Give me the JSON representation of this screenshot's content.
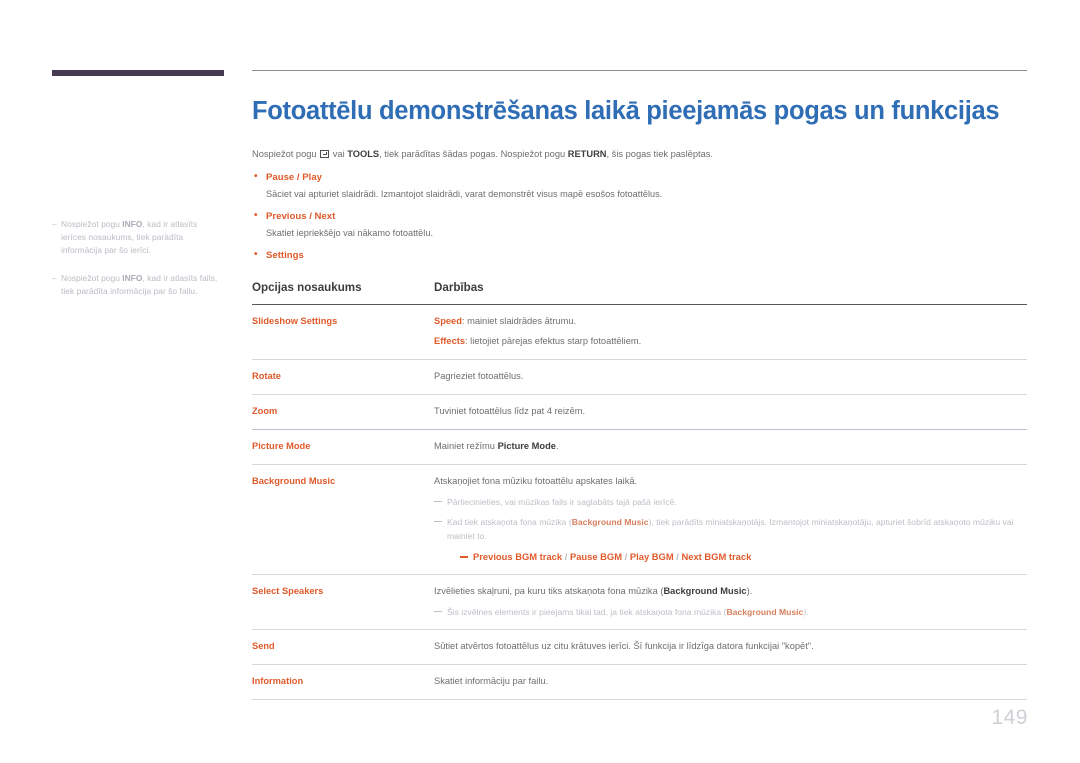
{
  "header": {
    "title": "Fotoattēlu demonstrēšanas laikā pieejamās pogas un funkcijas"
  },
  "intro": {
    "part1": "Nospiežot pogu ",
    "icon": "enter-key-icon",
    "part2": " vai ",
    "tools": "TOOLS",
    "part3": ", tiek parādītas šādas pogas. Nospiežot pogu ",
    "return": "RETURN",
    "part4": ", šis pogas tiek paslēptas."
  },
  "sidebar": {
    "notes": [
      {
        "dash": "–",
        "pre": "Nospiežot pogu ",
        "bold": "INFO",
        "post": ", kad ir atlasīts ierīces nosaukums, tiek parādīta informācija par šo ierīci."
      },
      {
        "dash": "–",
        "pre": "Nospiežot pogu ",
        "bold": "INFO",
        "post": ", kad ir atlasīts fails, tiek parādīta informācija par šo failu."
      }
    ]
  },
  "bullets": [
    {
      "label": "Pause / Play",
      "body": "Sāciet vai apturiet slaidrādi. Izmantojot slaidrādi, varat demonstrēt visus mapē esošos fotoattēlus."
    },
    {
      "label": "Previous / Next",
      "body": "Skatiet iepriekšējo vai nākamo fotoattēlu."
    },
    {
      "label": "Settings",
      "body": ""
    }
  ],
  "table": {
    "headers": [
      "Opcijas nosaukums",
      "Darbības"
    ],
    "rows": [
      {
        "name": "Slideshow Settings",
        "lines": [
          {
            "bold": "Speed",
            "text": ": mainiet slaidrādes ātrumu."
          },
          {
            "bold": "Effects",
            "text": ": lietojiet pārejas efektus starp fotoattēliem."
          }
        ]
      },
      {
        "name": "Rotate",
        "lines": [
          {
            "bold": "",
            "text": "Pagrieziet fotoattēlus."
          }
        ]
      },
      {
        "name": "Zoom",
        "lines": [
          {
            "bold": "",
            "text": "Tuviniet fotoattēlus līdz pat 4 reizēm."
          }
        ]
      },
      {
        "name": "Picture Mode",
        "lines": [
          {
            "bold": "",
            "text": "Mainiet režīmu "
          }
        ],
        "trailing_bold": "Picture Mode",
        "trailing_text": "."
      },
      {
        "name": "Background Music",
        "lines": [
          {
            "bold": "",
            "text": "Atskaņojiet fona mūziku fotoattēlu apskates laikā."
          }
        ],
        "sub_notes": [
          {
            "pre": "Pārliecinieties, vai mūzikas fails ir saglabāts tajā pašā ierīcē.",
            "bold": "",
            "post": ""
          },
          {
            "pre": "Kad tiek atskaņota fona mūzika (",
            "bold": "Background Music",
            "post": "), tiek parādīts miniatskaņotājs. Izmantojot miniatskaņotāju, apturiet šobrīd atskaņoto mūziku vai mainiet to."
          }
        ],
        "track_controls": [
          "Previous BGM track",
          "Pause BGM",
          "Play BGM",
          "Next BGM track"
        ],
        "track_separator": "/"
      },
      {
        "name": "Select Speakers",
        "lines": [
          {
            "bold": "",
            "text": "Izvēlieties skaļruni, pa kuru tiks atskaņota fona mūzika ("
          }
        ],
        "trailing_bold": "Background Music",
        "trailing_text": ").",
        "sub_notes": [
          {
            "pre": "Šis izvēlnes elements ir pieejams tikai tad, ja tiek atskaņota fona mūzika (",
            "bold": "Background Music",
            "post": ")."
          }
        ]
      },
      {
        "name": "Send",
        "lines": [
          {
            "bold": "",
            "text": "Sūtiet atvērtos fotoattēlus uz citu krātuves ierīci. Šī funkcija ir līdzīga datora funkcijai \"kopēt\"."
          }
        ]
      },
      {
        "name": "Information",
        "lines": [
          {
            "bold": "",
            "text": "Skatiet informāciju par failu."
          }
        ]
      }
    ]
  },
  "footer": {
    "page_number": "149"
  },
  "colors": {
    "title_blue": "#2f6db5",
    "accent_orange": "#e05a2b",
    "body_gray": "#6d6e72",
    "muted_gray": "#bcbfc6",
    "dark_bar": "#453a52",
    "purple_rule": "#c7b9d4"
  }
}
